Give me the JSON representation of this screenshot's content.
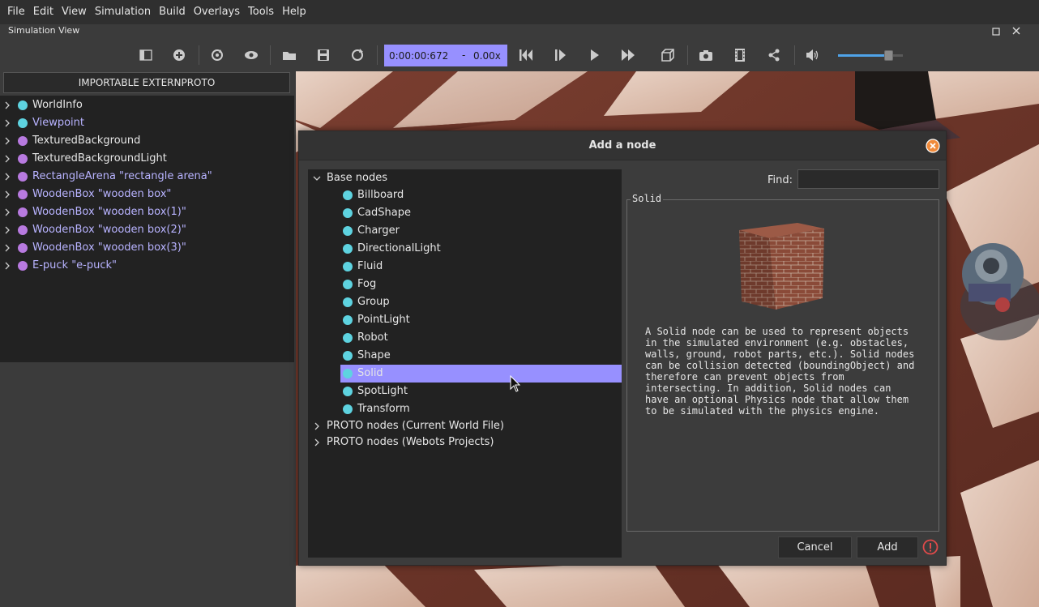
{
  "menubar": {
    "items": [
      "File",
      "Edit",
      "View",
      "Simulation",
      "Build",
      "Overlays",
      "Tools",
      "Help"
    ]
  },
  "dock": {
    "title": "Simulation View"
  },
  "toolbar": {
    "time": "0:00:00:672",
    "time_separator": "-",
    "speed": "0.00x",
    "volume_level": 0.78
  },
  "scene_tree": {
    "extern_button": "IMPORTABLE EXTERNPROTO",
    "items": [
      {
        "label": "WorldInfo",
        "dot": "#5ed3e0",
        "label_color": "#e6e6e6"
      },
      {
        "label": "Viewpoint",
        "dot": "#5ed3e0",
        "label_color": "#b8b3ff"
      },
      {
        "label": "TexturedBackground",
        "dot": "#b87ae0",
        "label_color": "#e6e6e6"
      },
      {
        "label": "TexturedBackgroundLight",
        "dot": "#b87ae0",
        "label_color": "#e6e6e6"
      },
      {
        "label": "RectangleArena \"rectangle arena\"",
        "dot": "#b87ae0",
        "label_color": "#b8b3ff"
      },
      {
        "label": "WoodenBox \"wooden box\"",
        "dot": "#b87ae0",
        "label_color": "#b8b3ff"
      },
      {
        "label": "WoodenBox \"wooden box(1)\"",
        "dot": "#b87ae0",
        "label_color": "#b8b3ff"
      },
      {
        "label": "WoodenBox \"wooden box(2)\"",
        "dot": "#b87ae0",
        "label_color": "#b8b3ff"
      },
      {
        "label": "WoodenBox \"wooden box(3)\"",
        "dot": "#b87ae0",
        "label_color": "#b8b3ff"
      },
      {
        "label": "E-puck \"e-puck\"",
        "dot": "#b87ae0",
        "label_color": "#b8b3ff"
      }
    ]
  },
  "dialog": {
    "title": "Add a node",
    "base_nodes_label": "Base nodes",
    "base_nodes": [
      "Billboard",
      "CadShape",
      "Charger",
      "DirectionalLight",
      "Fluid",
      "Fog",
      "Group",
      "PointLight",
      "Robot",
      "Shape",
      "Solid",
      "SpotLight",
      "Transform"
    ],
    "selected_node": "Solid",
    "proto_current": "PROTO nodes (Current World File)",
    "proto_projects": "PROTO nodes (Webots Projects)",
    "find_label": "Find:",
    "find_value": "",
    "info_title": "Solid",
    "info_description": "A Solid node can be used to represent objects\nin the simulated environment (e.g. obstacles,\nwalls, ground, robot parts, etc.). Solid nodes\ncan be collision detected (boundingObject) and\ntherefore can prevent objects from\nintersecting. In addition, Solid nodes can\nhave an optional Physics node that allow them\nto be simulated with the physics engine.",
    "cancel_label": "Cancel",
    "add_label": "Add"
  },
  "colors": {
    "accent": "#9790ff",
    "teal_dot": "#5ed3e0",
    "purple_dot": "#b87ae0",
    "close_orange": "#f08a3a",
    "warning_red": "#e04a4a"
  }
}
